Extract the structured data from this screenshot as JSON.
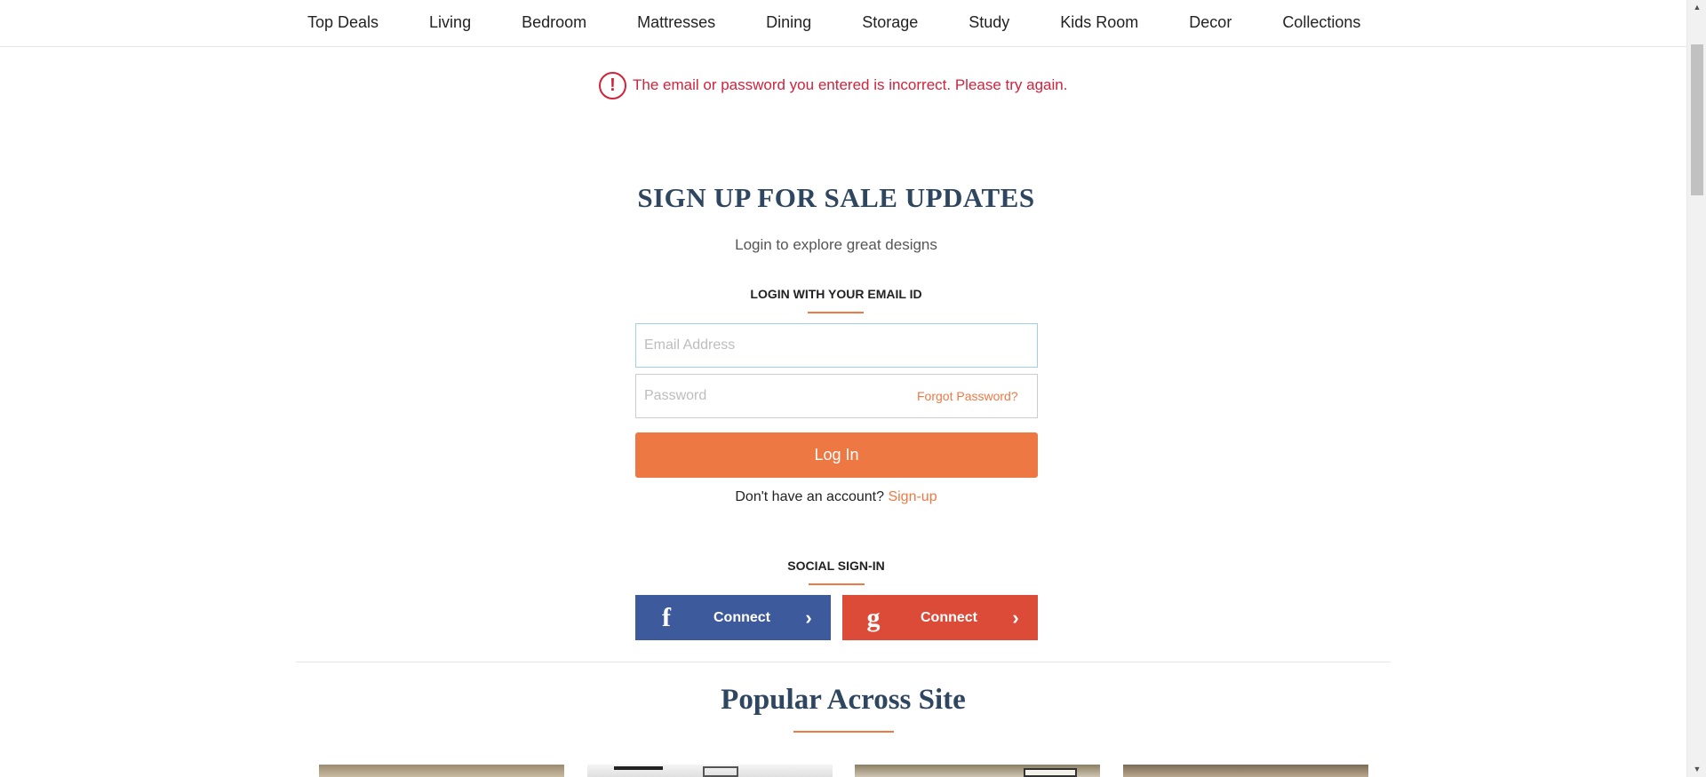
{
  "nav": {
    "items": [
      "Top Deals",
      "Living",
      "Bedroom",
      "Mattresses",
      "Dining",
      "Storage",
      "Study",
      "Kids Room",
      "Decor",
      "Collections"
    ]
  },
  "error": {
    "icon_text": "!",
    "message": "The email or password you entered is incorrect. Please try again.",
    "color": "#d0233c"
  },
  "login": {
    "heading": "SIGN UP FOR SALE UPDATES",
    "subheading": "Login to explore great designs",
    "email_section_title": "LOGIN WITH YOUR EMAIL ID",
    "email_placeholder": "Email Address",
    "password_placeholder": "Password",
    "forgot_password": "Forgot Password?",
    "login_button": "Log In",
    "signup_prompt": "Don't have an account?",
    "signup_link": "Sign-up",
    "accent_color": "#ee7844"
  },
  "social": {
    "title": "SOCIAL SIGN-IN",
    "facebook": {
      "glyph": "f",
      "label": "Connect",
      "chevron": "›",
      "color": "#3d5a9c"
    },
    "google": {
      "glyph": "g",
      "label": "Connect",
      "chevron": "›",
      "color": "#dc4a38"
    }
  },
  "popular": {
    "title": "Popular Across Site"
  },
  "icons": {
    "error": "exclamation-circle-icon",
    "facebook": "facebook-icon",
    "google": "google-icon",
    "chevron": "chevron-right-icon"
  }
}
